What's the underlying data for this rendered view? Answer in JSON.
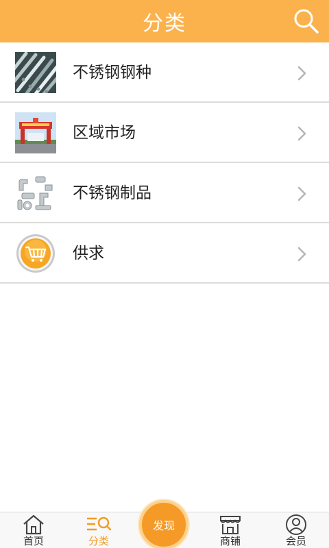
{
  "header": {
    "title": "分类",
    "search_icon": "search-icon"
  },
  "categories": [
    {
      "label": "不锈钢钢种",
      "thumbnail": "steel-pipes-image"
    },
    {
      "label": "区域市场",
      "thumbnail": "market-gate-image"
    },
    {
      "label": "不锈钢制品",
      "thumbnail": "pipe-fittings-image"
    },
    {
      "label": "供求",
      "thumbnail": "shopping-cart-image"
    }
  ],
  "tabbar": {
    "tabs": [
      {
        "label": "首页",
        "icon": "home-icon"
      },
      {
        "label": "分类",
        "icon": "category-icon",
        "active": true
      },
      {
        "label": "商铺",
        "icon": "shop-icon"
      },
      {
        "label": "会员",
        "icon": "member-icon"
      }
    ],
    "discover_label": "发现"
  },
  "colors": {
    "accent": "#fbb24c",
    "active_tab": "#f39b21",
    "discover": "#f59a27"
  }
}
